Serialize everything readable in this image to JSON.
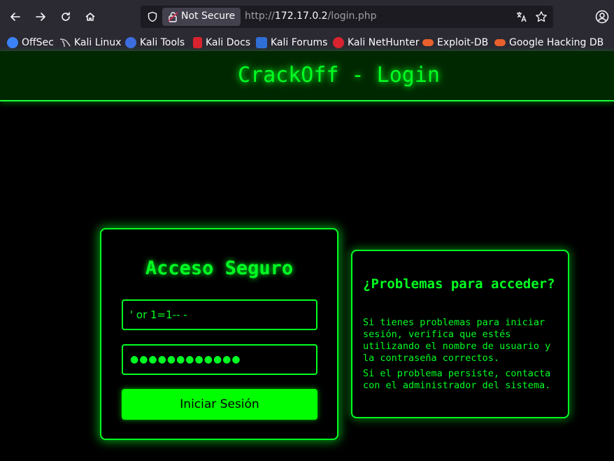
{
  "browser": {
    "security_label": "Not Secure",
    "url": {
      "protocol": "http://",
      "host": "172.17.0.2",
      "path": "/login.php"
    },
    "bookmarks": [
      {
        "label": "OffSec",
        "icon": "offsec-icon",
        "color": "#3b82f6"
      },
      {
        "label": "Kali Linux",
        "icon": "kali-dragon-icon",
        "color": "#c9c9c9"
      },
      {
        "label": "Kali Tools",
        "icon": "kali-tools-icon",
        "color": "#3d6ee0"
      },
      {
        "label": "Kali Docs",
        "icon": "kali-docs-icon",
        "color": "#d9232e"
      },
      {
        "label": "Kali Forums",
        "icon": "kali-forums-icon",
        "color": "#2f6fd6"
      },
      {
        "label": "Kali NetHunter",
        "icon": "nethunter-icon",
        "color": "#d9232e"
      },
      {
        "label": "Exploit-DB",
        "icon": "exploit-db-icon",
        "color": "#e8602c"
      },
      {
        "label": "Google Hacking DB",
        "icon": "ghdb-icon",
        "color": "#e8602c"
      }
    ]
  },
  "header": {
    "title": "CrackOff - Login"
  },
  "login": {
    "title": "Acceso Seguro",
    "username_value": "' or 1=1-- -",
    "password_value": "●●●●●●●●●●●●",
    "submit_label": "Iniciar Sesión"
  },
  "help": {
    "title": "¿Problemas para acceder?",
    "paragraph1": "Si tienes problemas para iniciar sesión, verifica que estés utilizando el nombre de usuario y la contraseña correctos.",
    "paragraph2": "Si el problema persiste, contacta con el administrador del sistema."
  },
  "colors": {
    "accent": "#00ff22",
    "header_bg": "#002800",
    "page_bg": "#000000"
  }
}
